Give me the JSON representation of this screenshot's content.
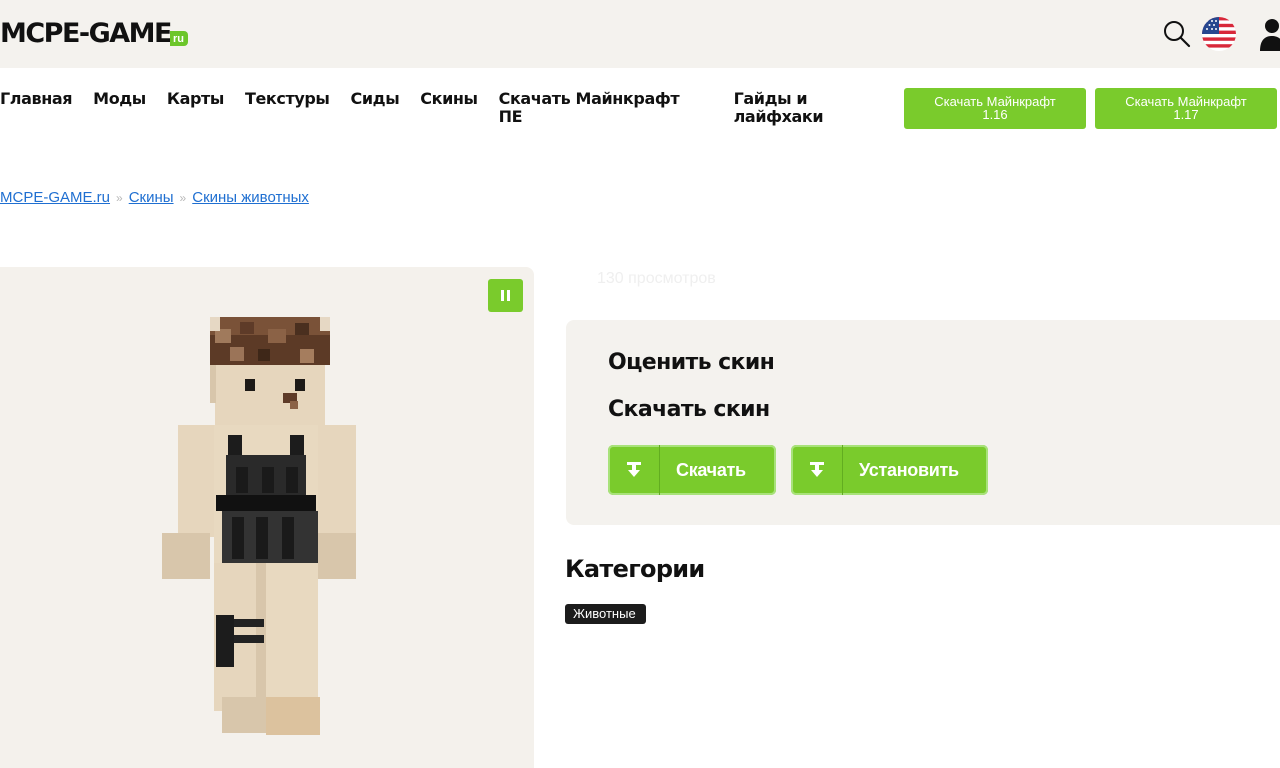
{
  "header": {
    "logo_main": "MCPE-GAME",
    "logo_suffix": "ru"
  },
  "nav": {
    "items": [
      "Главная",
      "Моды",
      "Карты",
      "Текстуры",
      "Сиды",
      "Скины",
      "Скачать Майнкрафт ПЕ",
      "Гайды и лайфхаки"
    ],
    "download_buttons": [
      {
        "line1": "Скачать Майнкрафт",
        "line2": "1.16"
      },
      {
        "line1": "Скачать Майнкрафт",
        "line2": "1.17"
      }
    ]
  },
  "breadcrumb": {
    "items": [
      "MCPE-GAME.ru",
      "Скины",
      "Скины животных"
    ],
    "separator": "»"
  },
  "preview": {
    "views": "130 просмотров"
  },
  "card": {
    "rate_title": "Оценить скин",
    "download_title": "Скачать скин",
    "download_label": "Скачать",
    "install_label": "Установить"
  },
  "categories": {
    "title": "Категории",
    "tags": [
      "Животные"
    ]
  },
  "colors": {
    "accent": "#7acb2c",
    "link": "#1f6fd1",
    "panel": "#f4f2ee"
  }
}
